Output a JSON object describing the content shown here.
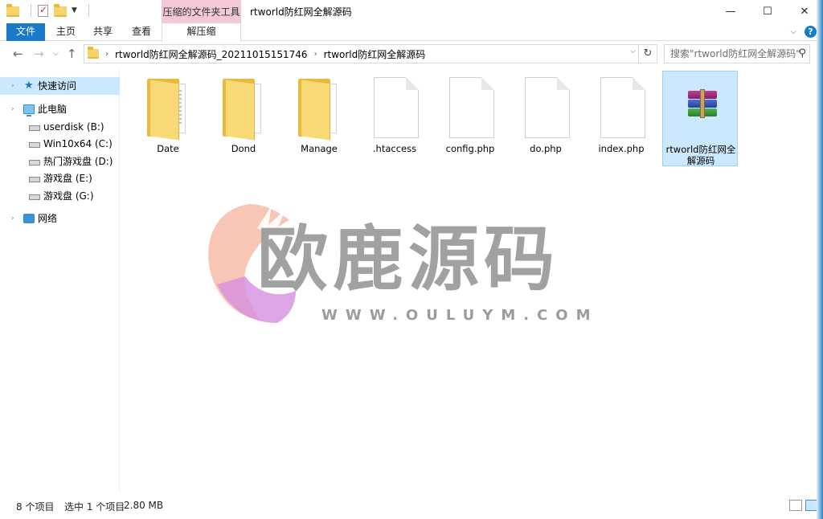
{
  "window": {
    "title": "rtworld防红网全解源码",
    "context_tab_header": "压缩的文件夹工具",
    "controls": {
      "minimize": "—",
      "maximize": "☐",
      "close": "✕"
    }
  },
  "ribbon": {
    "tabs": [
      "文件",
      "主页",
      "共享",
      "查看"
    ],
    "context_tab": "解压缩"
  },
  "address": {
    "crumbs": [
      "rtworld防红网全解源码_20211015151746",
      "rtworld防红网全解源码"
    ],
    "search_placeholder": "搜索\"rtworld防红网全解源码\""
  },
  "nav": {
    "quick_access": "快速访问",
    "this_pc": "此电脑",
    "drives": [
      "userdisk (B:)",
      "Win10x64 (C:)",
      "热门游戏盘 (D:)",
      "游戏盘 (E:)",
      "游戏盘 (G:)"
    ],
    "network": "网络"
  },
  "files": [
    {
      "name": "Date",
      "type": "folder"
    },
    {
      "name": "Dond",
      "type": "folder"
    },
    {
      "name": "Manage",
      "type": "folder"
    },
    {
      "name": ".htaccess",
      "type": "file"
    },
    {
      "name": "config.php",
      "type": "file"
    },
    {
      "name": "do.php",
      "type": "file"
    },
    {
      "name": "index.php",
      "type": "file"
    },
    {
      "name": "rtworld防红网全解源码",
      "type": "archive",
      "selected": true
    }
  ],
  "watermark": {
    "title": "欧鹿源码",
    "url": "WWW.OULUYM.COM"
  },
  "status": {
    "count": "8 个项目",
    "selection": "选中 1 个项目",
    "size": "2.80 MB"
  },
  "colors": {
    "accent": "#1979ca",
    "selection": "#cce8ff",
    "context_tab": "#f4c8d8"
  }
}
